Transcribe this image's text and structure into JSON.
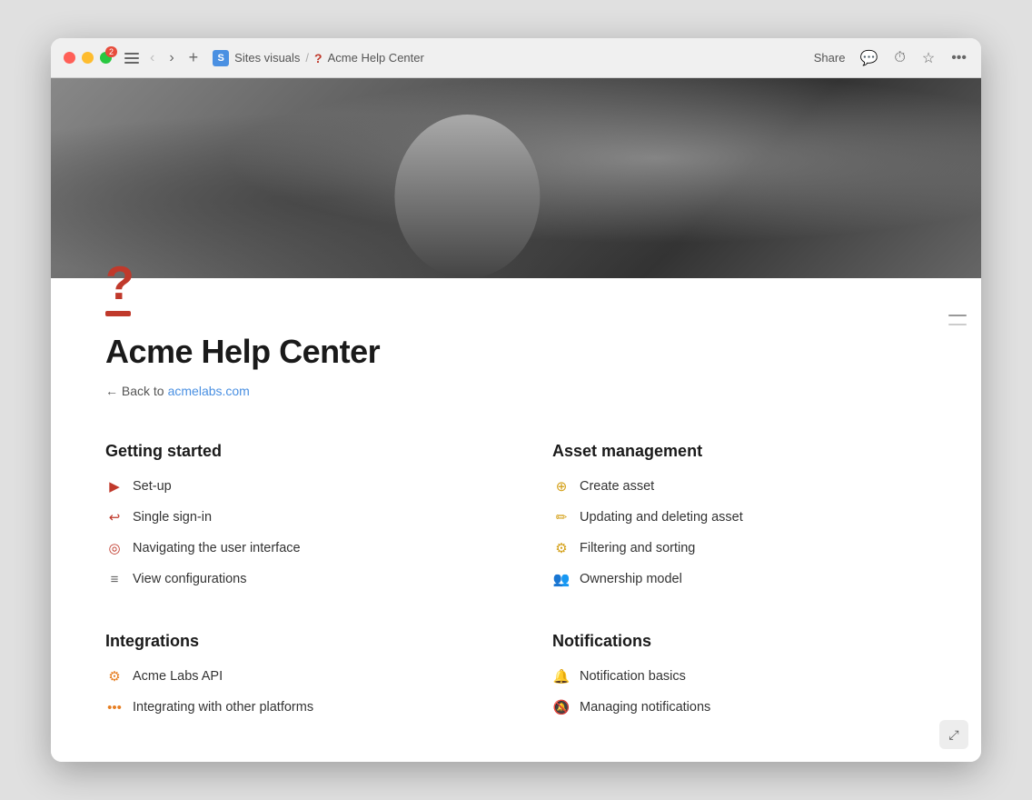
{
  "titlebar": {
    "badge_count": "2",
    "breadcrumb_site": "Sites visuals",
    "breadcrumb_separator": "/",
    "breadcrumb_page": "Acme Help Center",
    "share_label": "Share",
    "back_title": "Back to ",
    "back_url": "acmelabs.com"
  },
  "page": {
    "title": "Acme Help Center",
    "question_mark_icon": "?",
    "back_prefix": "← Back to ",
    "back_link": "acmelabs.com"
  },
  "sections": [
    {
      "id": "getting-started",
      "title": "Getting started",
      "links": [
        {
          "id": "setup",
          "icon": "▶",
          "icon_color": "icon-red",
          "label": "Set-up"
        },
        {
          "id": "sso",
          "icon": "↩",
          "icon_color": "icon-red",
          "label": "Single sign-in"
        },
        {
          "id": "nav-ui",
          "icon": "◎",
          "icon_color": "icon-red",
          "label": "Navigating the user interface"
        },
        {
          "id": "view-config",
          "icon": "≡",
          "icon_color": "icon-gray",
          "label": "View configurations"
        }
      ]
    },
    {
      "id": "asset-management",
      "title": "Asset management",
      "links": [
        {
          "id": "create-asset",
          "icon": "⊕",
          "icon_color": "icon-gold",
          "label": "Create asset"
        },
        {
          "id": "update-delete",
          "icon": "✏",
          "icon_color": "icon-gold",
          "label": "Updating and deleting asset"
        },
        {
          "id": "filter-sort",
          "icon": "⚙",
          "icon_color": "icon-gold",
          "label": "Filtering and sorting"
        },
        {
          "id": "ownership",
          "icon": "👥",
          "icon_color": "icon-gold",
          "label": "Ownership model"
        }
      ]
    },
    {
      "id": "integrations",
      "title": "Integrations",
      "links": [
        {
          "id": "api",
          "icon": "⚙",
          "icon_color": "icon-orange",
          "label": "Acme Labs API"
        },
        {
          "id": "platforms",
          "icon": "•••",
          "icon_color": "icon-orange",
          "label": "Integrating with other platforms"
        }
      ]
    },
    {
      "id": "notifications",
      "title": "Notifications",
      "links": [
        {
          "id": "notif-basics",
          "icon": "🔔",
          "icon_color": "icon-red",
          "label": "Notification basics"
        },
        {
          "id": "manage-notif",
          "icon": "🔕",
          "icon_color": "icon-gray",
          "label": "Managing notifications"
        }
      ]
    }
  ]
}
